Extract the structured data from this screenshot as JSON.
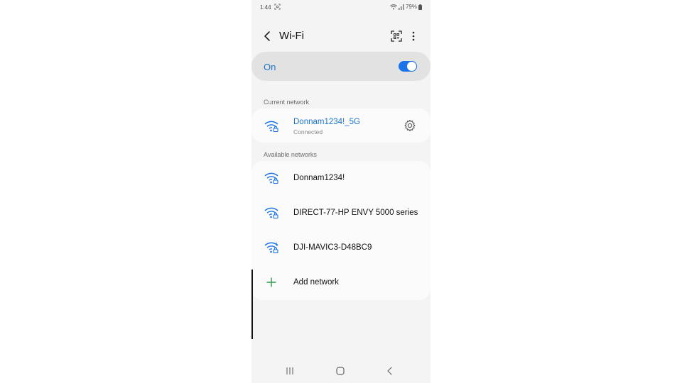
{
  "status_bar": {
    "time": "1:44",
    "battery": "79%"
  },
  "header": {
    "title": "Wi-Fi"
  },
  "toggle": {
    "label": "On",
    "state": "on"
  },
  "current_section": {
    "label": "Current network"
  },
  "current_network": {
    "name": "Donnam1234!_5G",
    "status": "Connected"
  },
  "available_section": {
    "label": "Available networks"
  },
  "available_networks": [
    {
      "name": "Donnam1234!"
    },
    {
      "name": "DIRECT-77-HP ENVY 5000 series"
    },
    {
      "name": "DJI-MAVIC3-D48BC9"
    }
  ],
  "add_network": {
    "label": "Add network"
  },
  "colors": {
    "accent": "#1a73e8",
    "plus": "#2e9a4a"
  }
}
